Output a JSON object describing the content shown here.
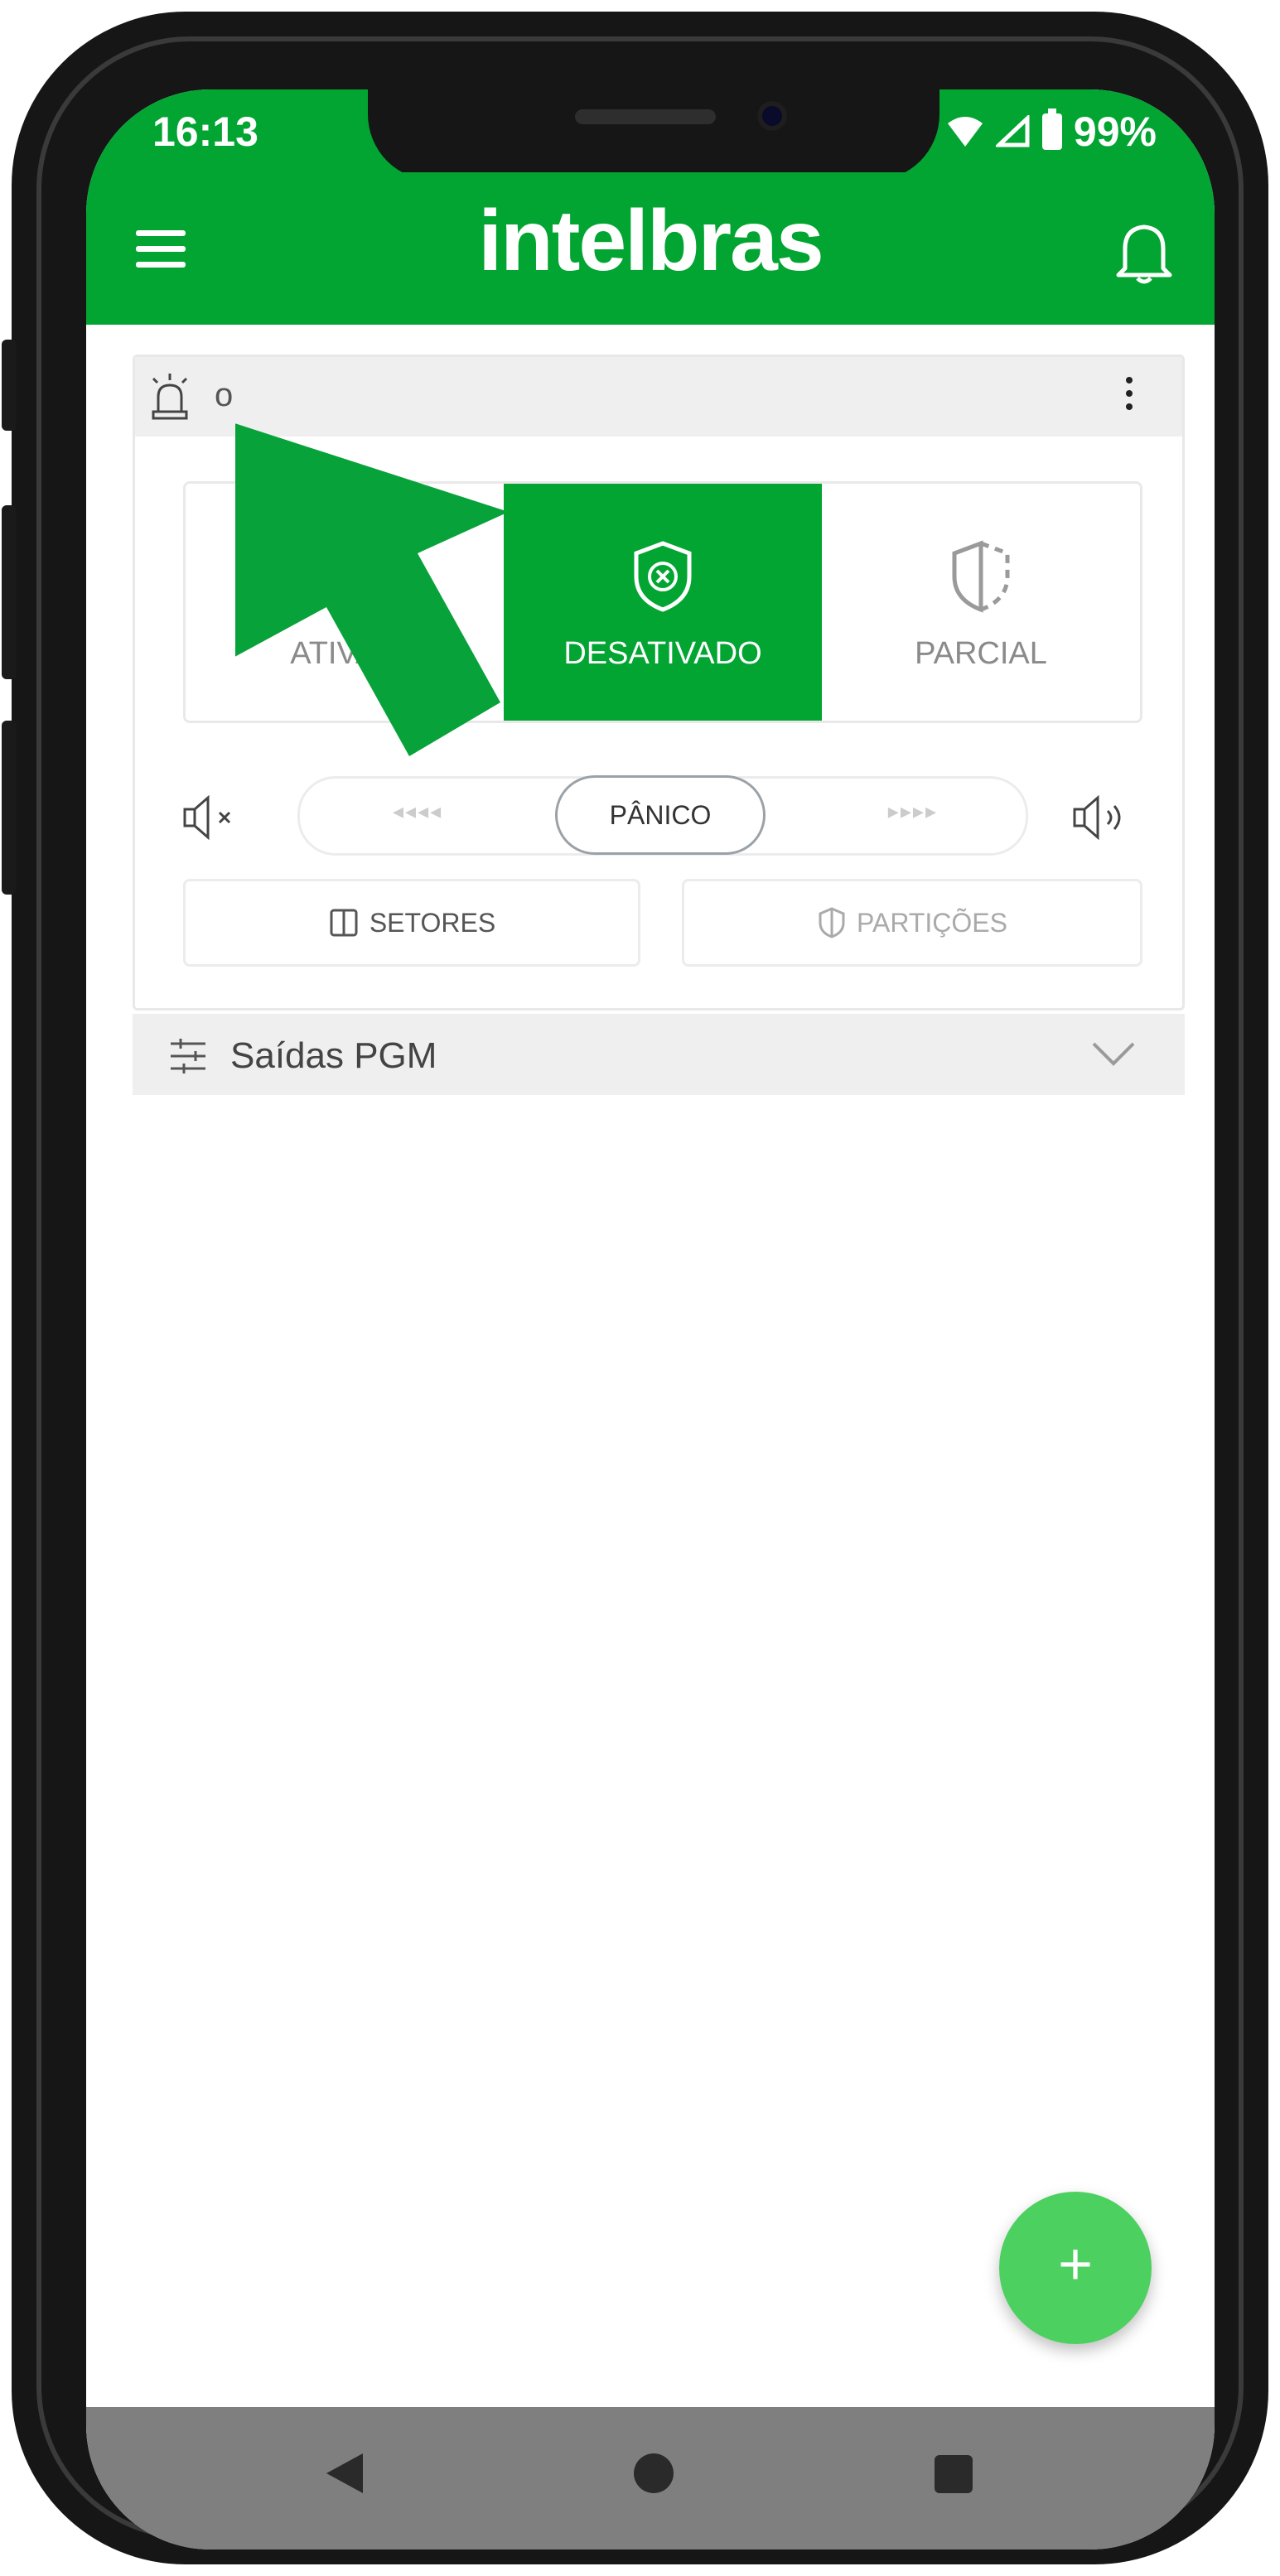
{
  "status_bar": {
    "time": "16:13",
    "battery": "99%"
  },
  "app_bar": {
    "brand": "intelbras",
    "menu_icon": "hamburger-menu-icon",
    "bell_icon": "bell-icon"
  },
  "panel": {
    "name": "o",
    "modes": [
      {
        "label": "ATIVAR",
        "icon": "shield-check-icon",
        "active": false
      },
      {
        "label": "DESATIVADO",
        "icon": "shield-x-icon",
        "active": true
      },
      {
        "label": "PARCIAL",
        "icon": "shield-half-icon",
        "active": false
      }
    ],
    "panic": {
      "label": "PÂNICO",
      "arrows_left": "◂◂◂◂",
      "arrows_right": "▸▸▸▸"
    },
    "setores_label": "SETORES",
    "particoes_label": "PARTIÇÕES"
  },
  "pgm": {
    "label": "Saídas PGM"
  },
  "fab": {
    "label": "+"
  },
  "colors": {
    "brand_green": "#03a532",
    "fab_green": "#4cd060",
    "arrow_green": "#07a239",
    "nav_gray": "#7f7f7f"
  }
}
